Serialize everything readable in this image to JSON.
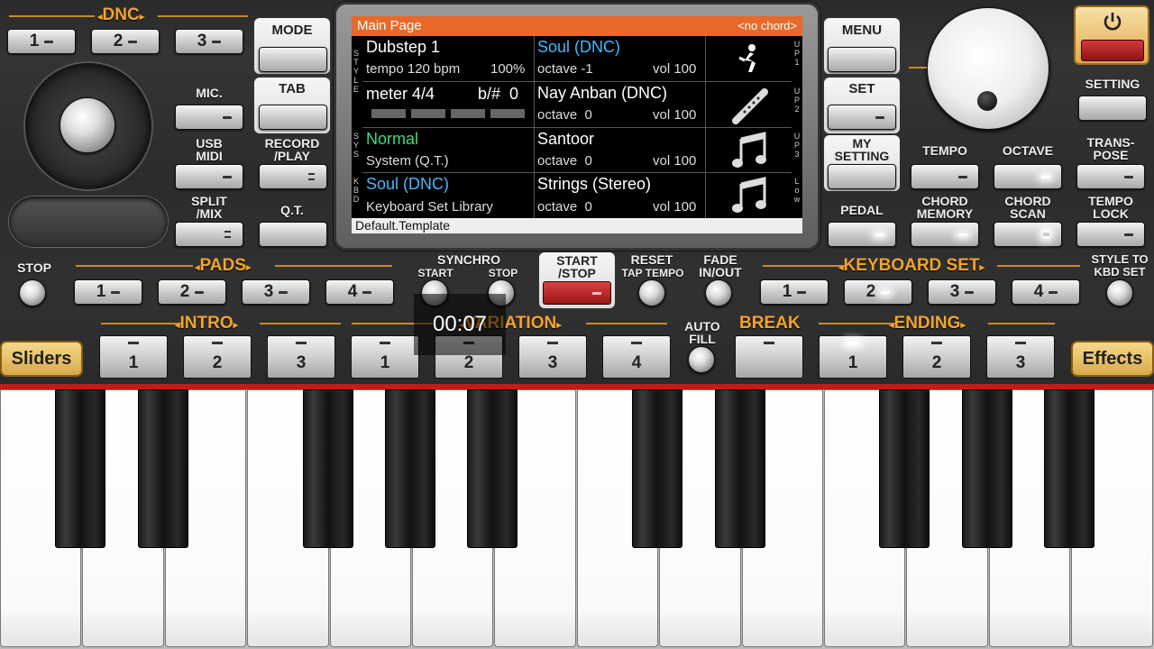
{
  "dnc": {
    "title": "DNC",
    "buttons": [
      "1",
      "2",
      "3"
    ]
  },
  "left": {
    "mic": "MIC.",
    "usb_midi": "USB\nMIDI",
    "split_mix": "SPLIT\n/MIX"
  },
  "mid_left": {
    "mode": "MODE",
    "tab": "TAB",
    "record_play": "RECORD\n/PLAY",
    "qt": "Q.T."
  },
  "screen": {
    "title": "Main Page",
    "chord": "<no chord>",
    "style_name": "Dubstep 1",
    "tempo": "tempo 120 bpm",
    "volume_pct": "100%",
    "meter": "meter 4/4",
    "bsharp": "b/#  0",
    "sys_name": "Normal",
    "sys_sub": "System (Q.T.)",
    "kbd_name": "Soul (DNC)",
    "kbd_sub": "Keyboard Set Library",
    "footer": "Default.Template",
    "side_style": "STYLE",
    "side_sys": "SYS",
    "side_kbd": "KBD",
    "parts": [
      {
        "name": "Soul (DNC)",
        "octave": "octave -1",
        "vol": "vol 100",
        "icon": "dancer-icon",
        "tag": "UP1"
      },
      {
        "name": "Nay Anban (DNC)",
        "octave": "octave  0",
        "vol": "vol 100",
        "icon": "flute-icon",
        "tag": "UP2"
      },
      {
        "name": "Santoor",
        "octave": "octave  0",
        "vol": "vol 100",
        "icon": "music-note-icon",
        "tag": "UP3"
      },
      {
        "name": "Strings (Stereo)",
        "octave": "octave  0",
        "vol": "vol 100",
        "icon": "music-note-icon",
        "tag": "Low"
      }
    ]
  },
  "right": {
    "menu": "MENU",
    "set": "SET",
    "my_setting": "MY\nSETTING",
    "pedal": "PEDAL",
    "setting": "SETTING",
    "tempo": "TEMPO",
    "octave": "OCTAVE",
    "transpose": "TRANS-\nPOSE",
    "chord_memory": "CHORD\nMEMORY",
    "chord_scan": "CHORD\nSCAN",
    "tempo_lock": "TEMPO\nLOCK"
  },
  "row2": {
    "stop": "STOP",
    "pads": "PADS",
    "pads_buttons": [
      "1",
      "2",
      "3",
      "4"
    ],
    "synchro": "SYNCHRO",
    "synchro_start": "START",
    "synchro_stop": "STOP",
    "start_stop": "START\n/STOP",
    "reset": "RESET",
    "tap_tempo": "TAP TEMPO",
    "fade": "FADE\nIN/OUT",
    "keyboard_set": "KEYBOARD SET",
    "kbd_buttons": [
      "1",
      "2",
      "3",
      "4"
    ],
    "style_to_kbd": "STYLE TO\nKBD SET"
  },
  "row3": {
    "intro": "INTRO",
    "intro_buttons": [
      "1",
      "2",
      "3"
    ],
    "variation": "VARIATION",
    "variation_buttons": [
      "1",
      "2",
      "3",
      "4"
    ],
    "auto_fill": "AUTO\nFILL",
    "break": "BREAK",
    "ending": "ENDING",
    "ending_buttons": [
      "1",
      "2",
      "3"
    ],
    "sliders": "Sliders",
    "effects": "Effects"
  },
  "timer": "00:07"
}
